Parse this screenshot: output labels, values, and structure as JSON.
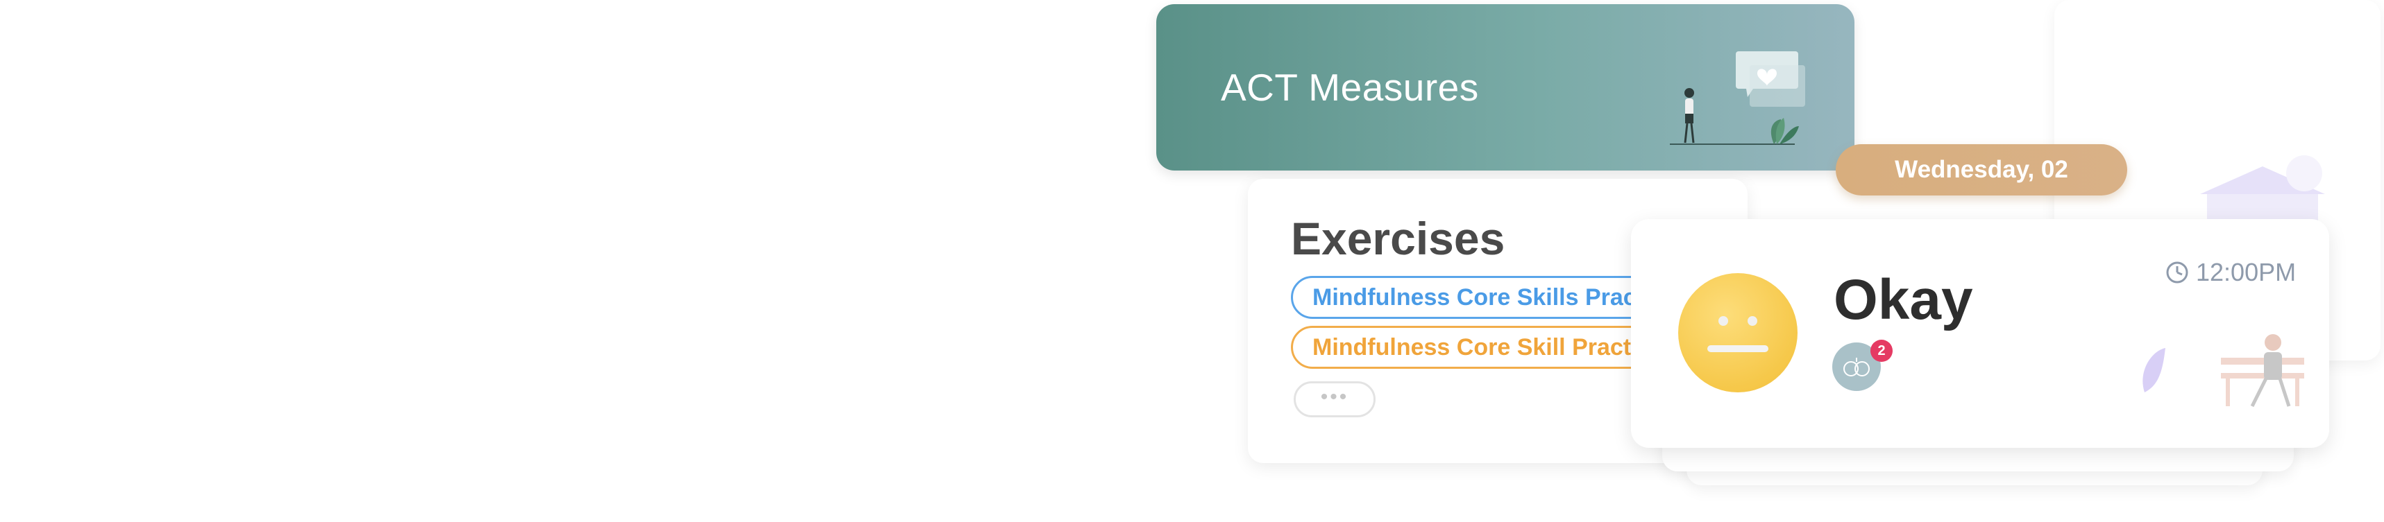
{
  "act": {
    "title": "ACT Measures"
  },
  "exercises": {
    "title": "Exercises",
    "chips": [
      "Mindfulness Core Skills Practice",
      "Mindfulness Core Skill Practice"
    ],
    "more_label": "•••"
  },
  "mood": {
    "date": "Wednesday, 02",
    "title": "Okay",
    "time": "12:00PM",
    "badge_count": "2"
  },
  "colors": {
    "act_gradient_start": "#5a9188",
    "chip_blue": "#4a9be6",
    "chip_orange": "#f0a43a",
    "date_pill": "#d8ae7e",
    "emoji": "#f6c84a",
    "badge": "#e53a63"
  },
  "icons": [
    "clock-icon",
    "heart-icon",
    "neutral-face-icon",
    "activity-icon"
  ]
}
